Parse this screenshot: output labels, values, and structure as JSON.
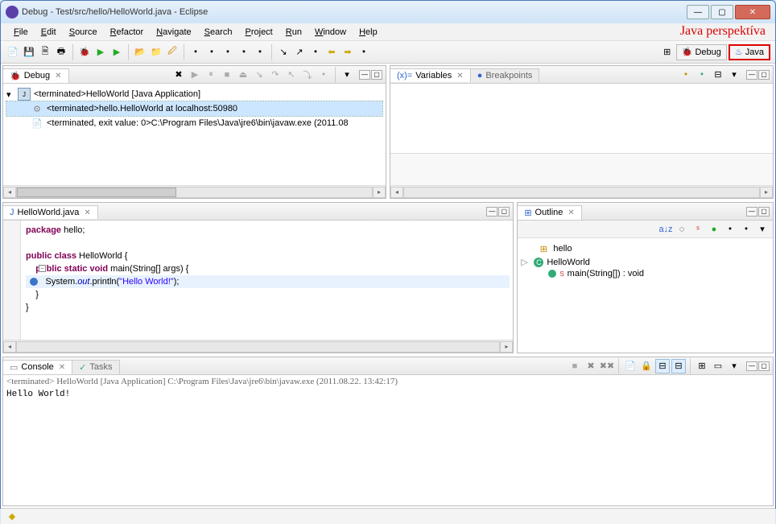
{
  "window": {
    "title": "Debug - Test/src/hello/HelloWorld.java - Eclipse"
  },
  "menu": [
    "File",
    "Edit",
    "Source",
    "Refactor",
    "Navigate",
    "Search",
    "Project",
    "Run",
    "Window",
    "Help"
  ],
  "annotation": "Java perspektíva",
  "perspectives": {
    "open_icon": "open-perspective",
    "debug": "Debug",
    "java": "Java"
  },
  "debug_view": {
    "tab": "Debug",
    "tree": [
      {
        "level": 0,
        "icon": "target",
        "text": "<terminated>HelloWorld [Java Application]"
      },
      {
        "level": 1,
        "icon": "vm",
        "text": "<terminated>hello.HelloWorld at localhost:50980",
        "selected": true
      },
      {
        "level": 1,
        "icon": "proc",
        "text": "<terminated, exit value: 0>C:\\Program Files\\Java\\jre6\\bin\\javaw.exe (2011.08"
      }
    ]
  },
  "vars_view": {
    "tab1": "Variables",
    "tab2": "Breakpoints"
  },
  "editor": {
    "tab": "HelloWorld.java",
    "lines": [
      {
        "t": "package",
        "rest": " hello;"
      },
      {
        "blank": true
      },
      {
        "t": "public class",
        "rest": " HelloWorld {"
      },
      {
        "indent": "    ",
        "t": "public static void",
        "rest": " main(String[] args) {",
        "fold": true
      },
      {
        "indent": "        ",
        "pre": "System.",
        "field": "out",
        "mid": ".println(",
        "str": "\"Hello World!\"",
        "post": ");",
        "hl": true,
        "bp": true
      },
      {
        "indent": "    ",
        "rest": "}"
      },
      {
        "rest": "}"
      }
    ]
  },
  "outline": {
    "tab": "Outline",
    "items": [
      {
        "level": 0,
        "icon": "package",
        "text": "hello"
      },
      {
        "level": 0,
        "icon": "class",
        "text": "HelloWorld",
        "expander": "▷"
      },
      {
        "level": 1,
        "icon": "method-s",
        "text": "main(String[]) : void"
      }
    ]
  },
  "console": {
    "tab1": "Console",
    "tab2": "Tasks",
    "header": "<terminated> HelloWorld [Java Application] C:\\Program Files\\Java\\jre6\\bin\\javaw.exe (2011.08.22. 13:42:17)",
    "output": "Hello World!"
  }
}
